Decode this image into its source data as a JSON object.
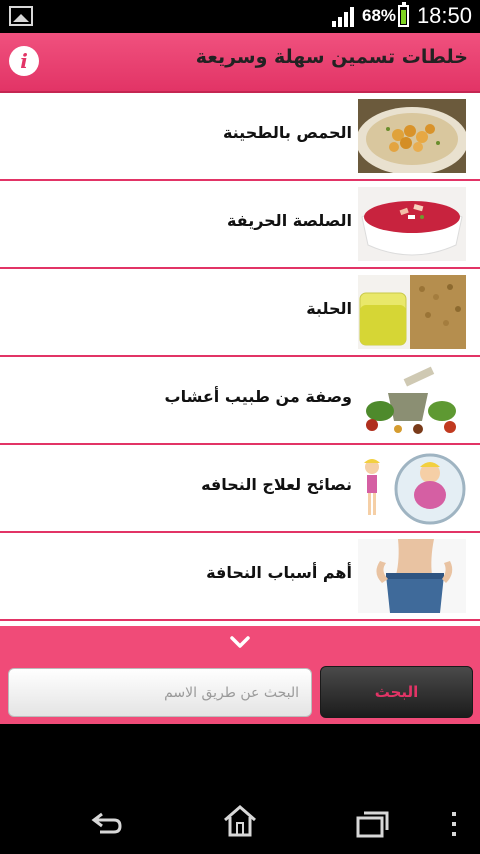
{
  "status_bar": {
    "battery_percent": "68%",
    "time": "18:50",
    "icons": [
      "gallery-icon",
      "signal-icon",
      "battery-icon"
    ]
  },
  "header": {
    "info_icon": "i",
    "title": "خلطات تسمين سهلة وسريعة"
  },
  "recipes": [
    {
      "label": "الحمص بالطحينة",
      "thumb": "hummus"
    },
    {
      "label": "الصلصة الحريفة",
      "thumb": "spicy-sauce"
    },
    {
      "label": "الحلبة",
      "thumb": "fenugreek"
    },
    {
      "label": "وصفة من طبيب أعشاب",
      "thumb": "herbs"
    },
    {
      "label": "نصائح لعلاج النحافه",
      "thumb": "weight-cartoon"
    },
    {
      "label": "أهم أسباب النحافة",
      "thumb": "thin-waist"
    }
  ],
  "search": {
    "placeholder": "البحث عن طريق الاسم",
    "button_label": "البحث"
  },
  "colors": {
    "accent": "#e23466",
    "panel": "#f04b78"
  },
  "nav": [
    "back-icon",
    "home-icon",
    "recent-apps-icon",
    "overflow-menu-icon"
  ]
}
